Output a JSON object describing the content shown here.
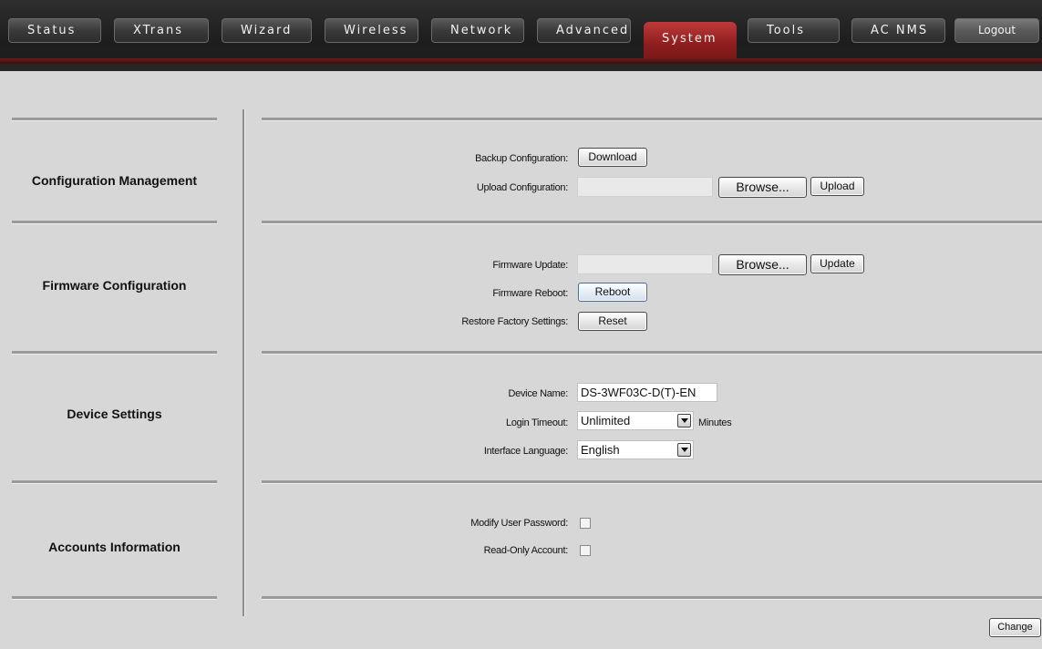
{
  "nav": {
    "tabs": [
      {
        "label": "Status"
      },
      {
        "label": "XTrans"
      },
      {
        "label": "Wizard"
      },
      {
        "label": "Wireless"
      },
      {
        "label": "Network"
      },
      {
        "label": "Advanced"
      },
      {
        "label": "System",
        "active": true
      },
      {
        "label": "Tools"
      },
      {
        "label": "AC NMS"
      }
    ],
    "logout_label": "Logout"
  },
  "colors": {
    "accent": "#8c1d1d",
    "background": "#d7d7d7"
  },
  "sections": {
    "config": {
      "title": "Configuration Management",
      "backup_label": "Backup Configuration:",
      "download_label": "Download",
      "upload_label": "Upload Configuration:",
      "browse_label": "Browse...",
      "upload_button": "Upload"
    },
    "firmware": {
      "title": "Firmware Configuration",
      "update_label": "Firmware Update:",
      "browse_label": "Browse...",
      "update_button": "Update",
      "reboot_label": "Firmware Reboot:",
      "reboot_button": "Reboot",
      "restore_label": "Restore Factory Settings:",
      "reset_button": "Reset"
    },
    "device": {
      "title": "Device Settings",
      "name_label": "Device Name:",
      "name_value": "DS-3WF03C-D(T)-EN",
      "timeout_label": "Login Timeout:",
      "timeout_value": "Unlimited",
      "timeout_suffix": "Minutes",
      "language_label": "Interface Language:",
      "language_value": "English"
    },
    "accounts": {
      "title": "Accounts Information",
      "modify_label": "Modify User Password:",
      "readonly_label": "Read-Only Account:"
    }
  },
  "footer": {
    "change_label": "Change"
  }
}
